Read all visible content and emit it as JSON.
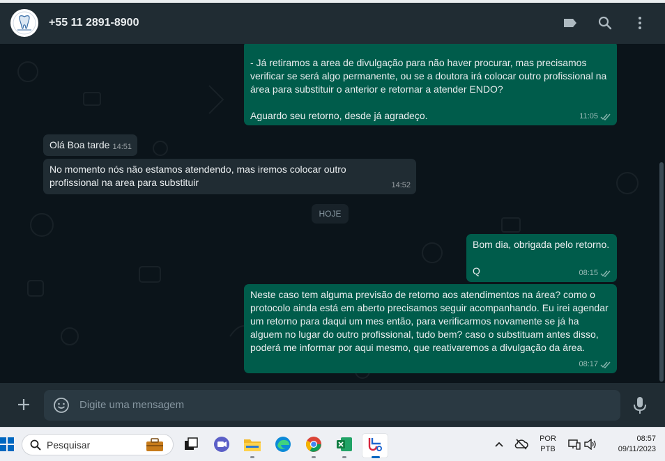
{
  "header": {
    "contact_name": "+55 11 2891-8900",
    "icons": [
      "label-icon",
      "search-icon",
      "menu-icon"
    ]
  },
  "messages": [
    {
      "direction": "outgoing",
      "text": "- Já retiramos a area de divulgação para não haver procurar, mas precisamos verificar se será algo permanente, ou se a doutora irá colocar outro profissional na área para substituir o anterior e retornar a atender ENDO?\n\nAguardo seu retorno, desde já agradeço.",
      "time": "11:05",
      "status": "read"
    },
    {
      "direction": "incoming",
      "text": "Olá Boa tarde",
      "time": "14:51"
    },
    {
      "direction": "incoming",
      "text": "No momento nós não estamos atendendo, mas iremos colocar outro profissional na area para substituir",
      "time": "14:52"
    },
    {
      "direction": "outgoing",
      "text": "Bom dia, obrigada pelo retorno.\n\nQ",
      "time": "08:15",
      "status": "read"
    },
    {
      "direction": "outgoing",
      "text": "Neste caso tem alguma previsão de retorno aos atendimentos na área? como o protocolo ainda está em aberto precisamos seguir acompanhando. Eu irei agendar um retorno para daqui um mes então, para verificarmos novamente se já ha alguem no lugar do outro profissional, tudo bem? caso o substituam antes disso, poderá me informar por aqui mesmo, que reativaremos a divulgação da área.",
      "time": "08:17",
      "status": "read"
    }
  ],
  "date_divider": "HOJE",
  "composer": {
    "placeholder": "Digite uma mensagem"
  },
  "taskbar": {
    "search_label": "Pesquisar",
    "apps": [
      "briefcase-icon",
      "task-view-icon",
      "teams-icon",
      "file-explorer-icon",
      "edge-icon",
      "chrome-icon",
      "excel-icon",
      "snipping-tool-icon"
    ],
    "language_line1": "POR",
    "language_line2": "PTB",
    "time": "08:57",
    "date": "09/11/2023"
  },
  "colors": {
    "outgoing_bubble": "#005c4b",
    "incoming_bubble": "#202c33",
    "chat_background": "#0b141a",
    "header": "#202c33"
  }
}
